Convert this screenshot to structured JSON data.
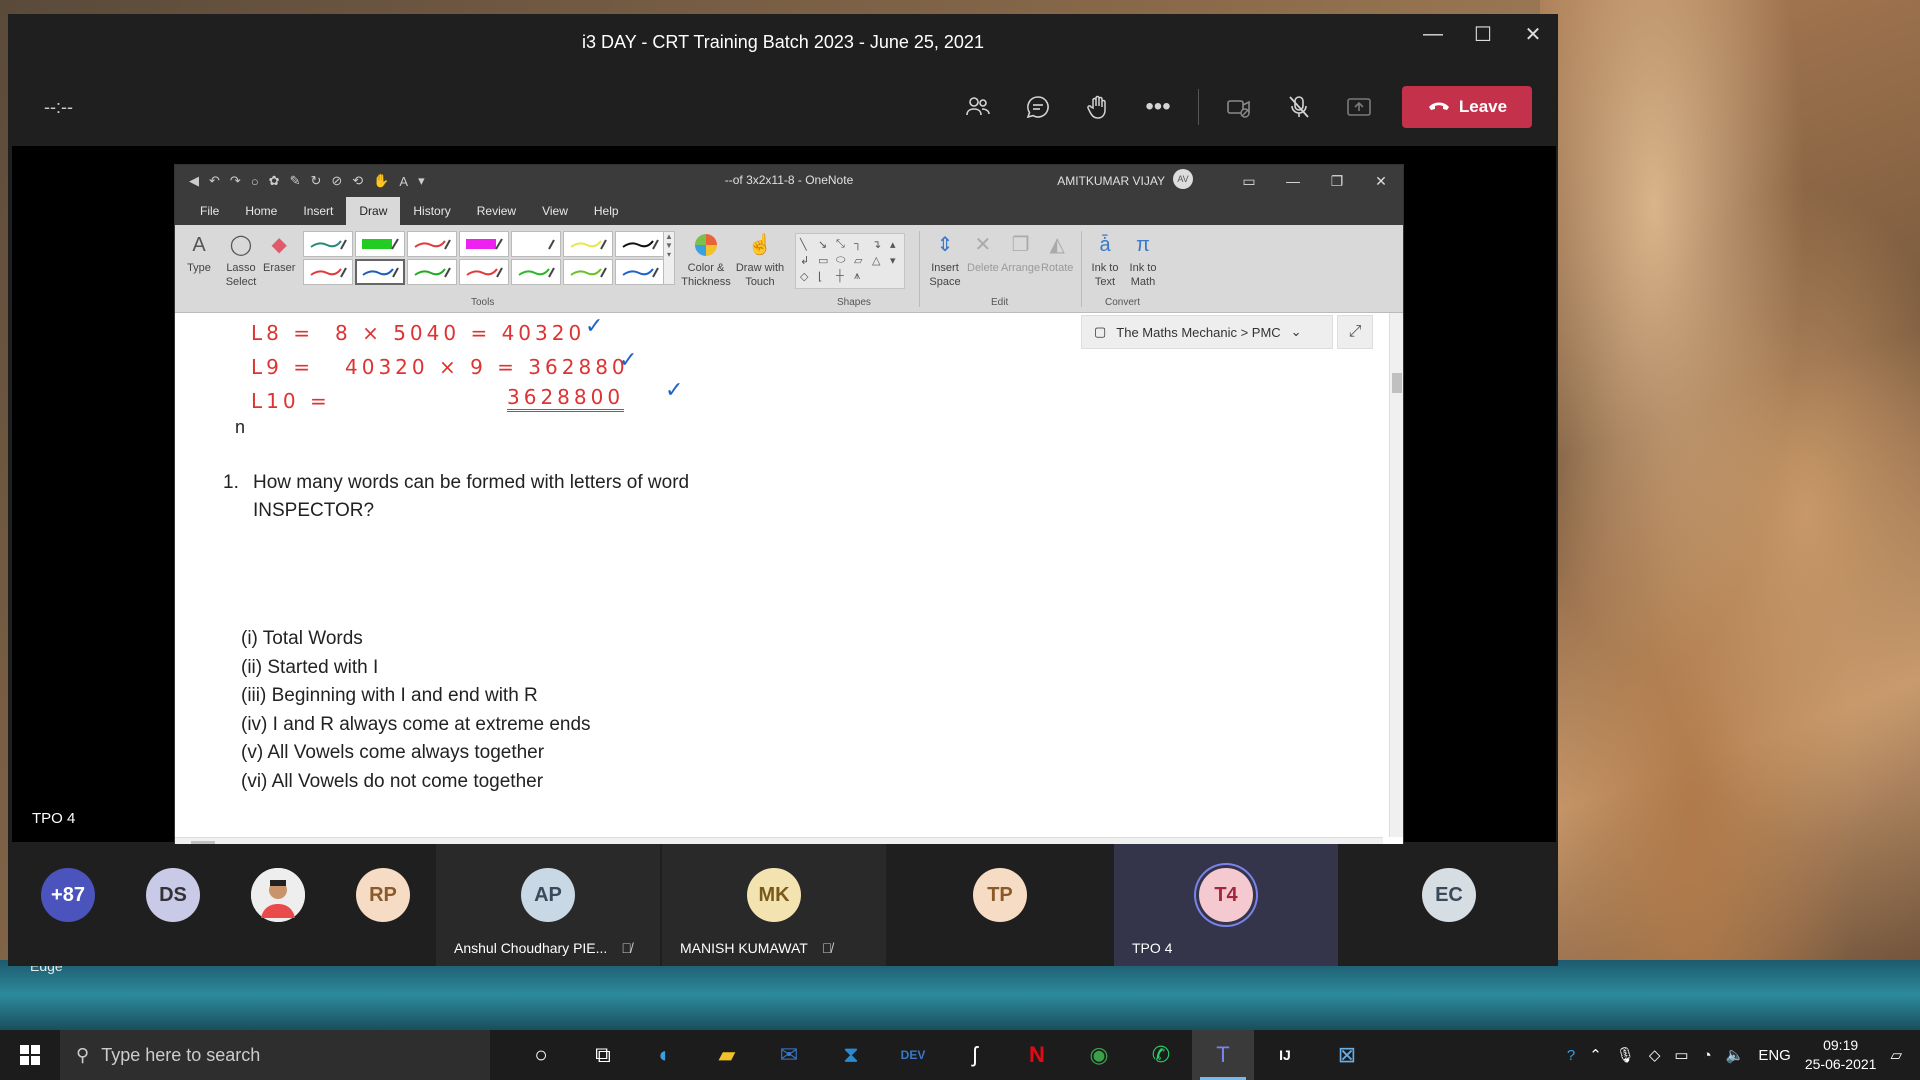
{
  "window": {
    "title": "i3 DAY - CRT Training Batch 2023 - June 25, 2021",
    "controls": {
      "minimize": "—",
      "maximize": "☐",
      "close": "✕"
    }
  },
  "meeting_toolbar": {
    "timer": "--:--",
    "icons": [
      "people-icon",
      "chat-icon",
      "raise-hand-icon",
      "more-icon",
      "camera-off-icon",
      "mic-off-icon",
      "share-icon"
    ],
    "leave_label": "Leave",
    "leave_color": "#c4314b"
  },
  "stage": {
    "presenter_label": "TPO 4"
  },
  "onenote": {
    "doc_title": "--of 3x2x11-8 - OneNote",
    "user_name": "AMITKUMAR VIJAY",
    "user_initials": "AV",
    "menu": [
      "File",
      "Home",
      "Insert",
      "Draw",
      "History",
      "Review",
      "View",
      "Help"
    ],
    "active_menu": "Draw",
    "ribbon": {
      "type": "Type",
      "lasso": "Lasso Select",
      "eraser": "Eraser",
      "tools_group": "Tools",
      "color_thickness": "Color & Thickness",
      "draw_with_touch": "Draw with Touch",
      "shapes_group": "Shapes",
      "insert_space": "Insert Space",
      "delete": "Delete",
      "arrange": "Arrange",
      "rotate": "Rotate",
      "edit_group": "Edit",
      "ink_to_text": "Ink to Text",
      "ink_to_math": "Ink to Math",
      "convert_group": "Convert"
    },
    "pen_colors": [
      "#2a8a7a",
      "#22cc22",
      "#e23a3a",
      "#ee22ee",
      "#ffffff",
      "#e8e84a",
      "#111111",
      "#e23a3a",
      "#1d5fb5",
      "#22aa22",
      "#e23a3a",
      "#2ab82a",
      "#6ac02a",
      "#1d63c9"
    ],
    "breadcrumb": "The Maths Mechanic > PMC",
    "ink": {
      "line1_label": "L8 =",
      "line1_expr": "8 × 5040 = 40320",
      "line2_label": "L9 =",
      "line2_expr": "40320 × 9 = 362880",
      "line3_label": "L10 =",
      "line3_expr": "3628800",
      "tick": "✓"
    },
    "stray_char": "n",
    "question_number": "1.",
    "question_text": "How many words can be formed with letters of word INSPECTOR?",
    "items": [
      "(i) Total Words",
      "(ii) Started with I",
      "(iii) Beginning with I and end with R",
      "(iv) I and R always come at extreme ends",
      "(v) All Vowels come always together",
      "(vi) All Vowels do not come together"
    ]
  },
  "participants": [
    {
      "initials": "+87",
      "name": "",
      "bg": "#4b53bc",
      "fg": "#ffffff"
    },
    {
      "initials": "DS",
      "name": "",
      "bg": "#c9c9e8",
      "fg": "#333333"
    },
    {
      "initials": "",
      "name": "",
      "bg": "#e8e8e8",
      "fg": "#333333"
    },
    {
      "initials": "RP",
      "name": "",
      "bg": "#f6dcc4",
      "fg": "#8a5a2a"
    },
    {
      "initials": "AP",
      "name": "Anshul Choudhary PIE...",
      "bg": "#c8d8e4",
      "fg": "#3a4a5a"
    },
    {
      "initials": "MK",
      "name": "MANISH KUMAWAT",
      "bg": "#f3e3b0",
      "fg": "#7a5a1a"
    },
    {
      "initials": "TP",
      "name": "",
      "bg": "#f6dcc4",
      "fg": "#8a5a2a"
    },
    {
      "initials": "T4",
      "name": "TPO 4",
      "bg": "#f5c9d0",
      "fg": "#a3263e"
    },
    {
      "initials": "EC",
      "name": "",
      "bg": "#d6dee4",
      "fg": "#3a4a5a"
    }
  ],
  "desktop": {
    "edge_label": "Edge"
  },
  "taskbar": {
    "search_placeholder": "Type here to search",
    "apps": [
      "cortana-icon",
      "task-view-icon",
      "edge-icon",
      "file-explorer-icon",
      "mail-icon",
      "vscode-icon",
      "devcpp-icon",
      "app-s-icon",
      "netflix-icon",
      "chrome-icon",
      "whatsapp-icon",
      "teams-icon",
      "intellij-icon",
      "app-icon"
    ],
    "language": "ENG",
    "time": "09:19",
    "date": "25-06-2021"
  }
}
